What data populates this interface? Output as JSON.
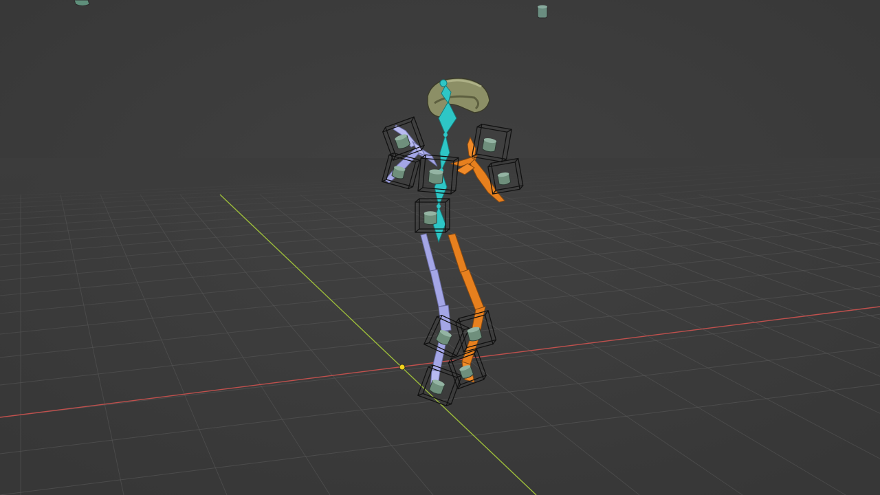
{
  "viewport": {
    "view": "3D Viewport",
    "mode": "Pose"
  },
  "grid": {
    "background_color": "#3d3d3d",
    "floor_line_color": "#5a5a5a",
    "x_axis_color": "#c0504d",
    "y_axis_color": "#9bbb3a",
    "origin_color": "#f2d21b"
  },
  "rig": {
    "spine_color": "#2ec6c6",
    "left_color": "#a4a6e6",
    "right_color": "#e7801e",
    "control_color": "#6f8f7c",
    "head_prop_color": "#8c8f66",
    "widget_box_color": "#111111"
  },
  "icons": {
    "scene_object_1": "cylinder-icon",
    "scene_object_2": "cylinder-icon"
  }
}
